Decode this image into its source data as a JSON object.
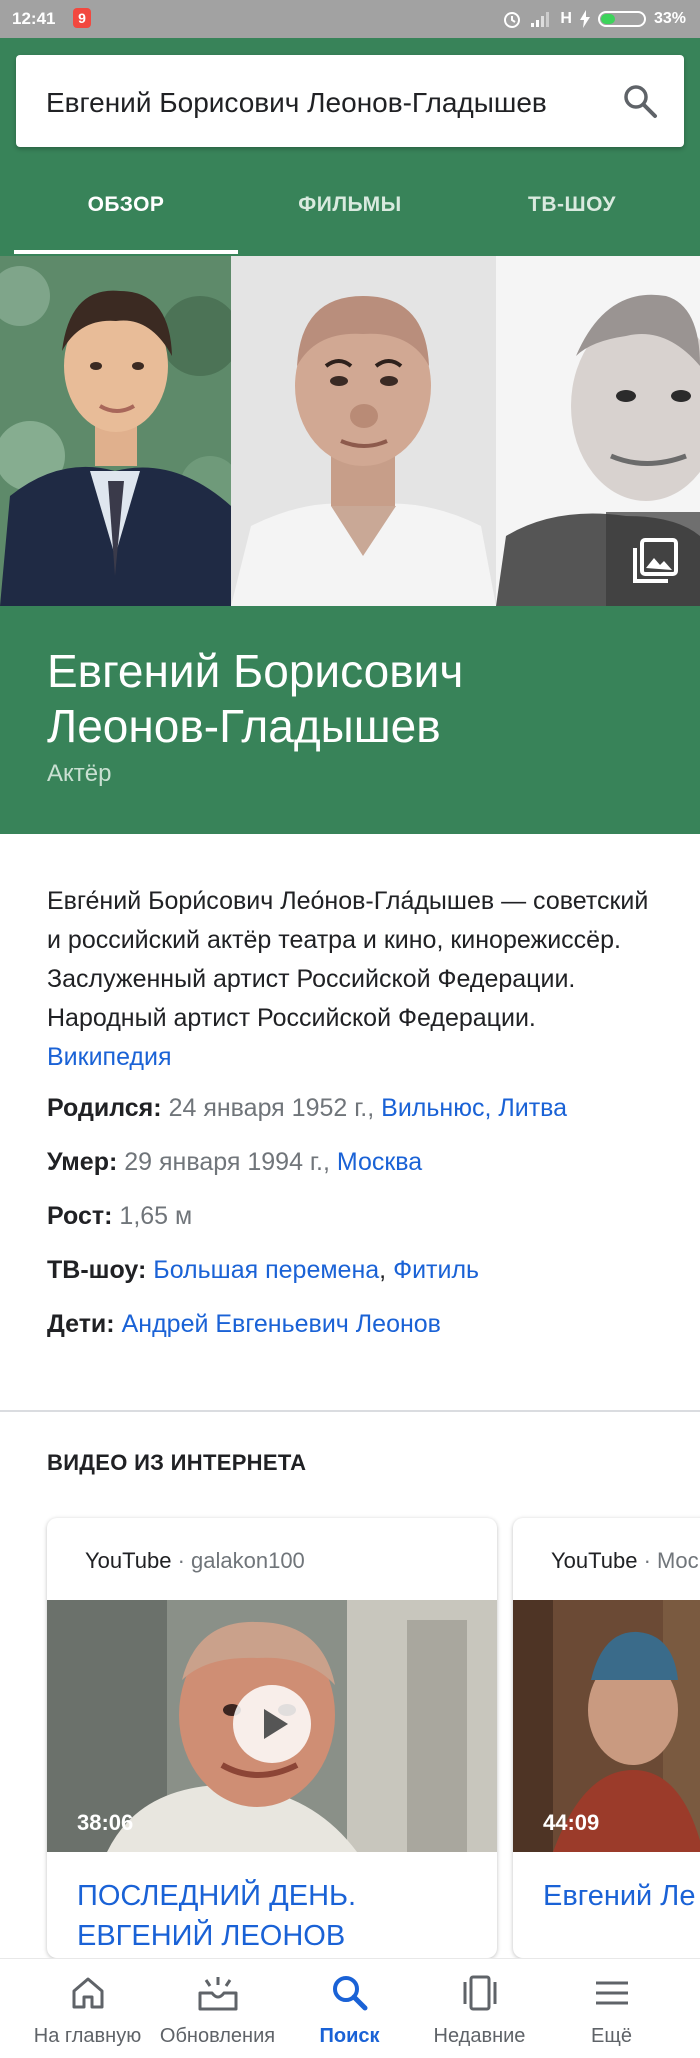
{
  "status_bar": {
    "time": "12:41",
    "app_badge": "9",
    "network": "H",
    "battery": "33%",
    "battery_level": 0.33
  },
  "search": {
    "query": "Евгений Борисович Леонов-Гладышев"
  },
  "tabs": [
    {
      "label": "ОБЗОР",
      "active": true
    },
    {
      "label": "ФИЛЬМЫ",
      "active": false
    },
    {
      "label": "ТВ-ШОУ",
      "active": false
    }
  ],
  "entity": {
    "name_line1": "Евгений Борисович",
    "name_line2": "Леонов-Гладышев",
    "role": "Актёр"
  },
  "description": {
    "text": "Евге́ний Бори́сович Лео́нов-Гла́дышев — советский и российский актёр театра и кино, кинорежиссёр. Заслуженный артист Российской Федерации. Народный артист Российской Федерации.",
    "source": "Википедия"
  },
  "facts": {
    "born": {
      "label": "Родился:",
      "value": "24 января 1952 г.,",
      "link": "Вильнюс, Литва"
    },
    "died": {
      "label": "Умер:",
      "value": "29 января 1994 г.,",
      "link": "Москва"
    },
    "height": {
      "label": "Рост:",
      "value": "1,65 м"
    },
    "tv": {
      "label": "ТВ-шоу:",
      "link1": "Большая перемена",
      "sep": ",",
      "link2": "Фитиль"
    },
    "children": {
      "label": "Дети:",
      "link": "Андрей Евгеньевич Леонов"
    }
  },
  "videos": {
    "section_title": "ВИДЕО ИЗ ИНТЕРНЕТА",
    "items": [
      {
        "source": "YouTube",
        "channel": "· galakon100",
        "duration": "38:06",
        "title_line1": "ПОСЛЕДНИЙ ДЕНЬ.",
        "title_line2": "ЕВГЕНИЙ ЛЕОНОВ"
      },
      {
        "source": "YouTube",
        "channel": "· Moc",
        "duration": "44:09",
        "title_line1": "Евгений Ле",
        "title_line2": ""
      }
    ]
  },
  "bottom_nav": [
    {
      "label": "На главную",
      "icon": "home-icon"
    },
    {
      "label": "Обновления",
      "icon": "updates-icon"
    },
    {
      "label": "Поиск",
      "icon": "search-icon",
      "active": true
    },
    {
      "label": "Недавние",
      "icon": "recent-icon"
    },
    {
      "label": "Ещё",
      "icon": "menu-icon"
    }
  ],
  "colors": {
    "brand_green": "#388359",
    "link_blue": "#1a62d6",
    "status_bar": "#a2a2a2"
  }
}
